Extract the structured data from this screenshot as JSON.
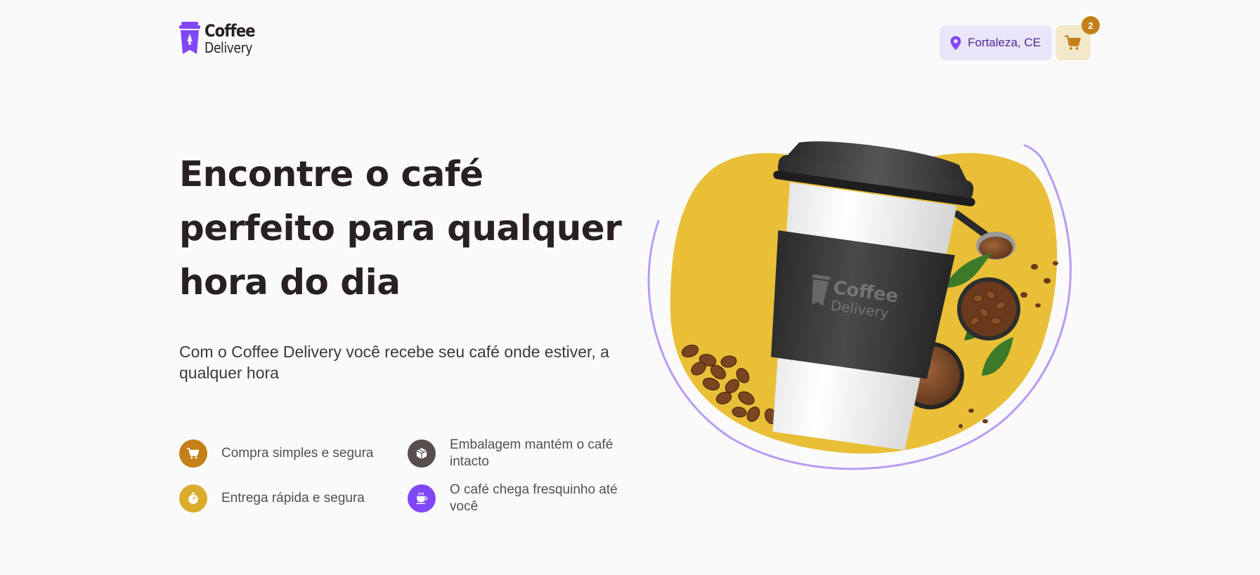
{
  "header": {
    "logo": {
      "line1": "Coffee",
      "line2": "Delivery",
      "icon": "coffee-cup-rocket-icon"
    },
    "location": {
      "text": "Fortaleza, CE",
      "icon": "map-pin-icon"
    },
    "cart": {
      "count": "2",
      "icon": "shopping-cart-icon"
    }
  },
  "hero": {
    "title_lines": [
      "Encontre o café",
      "perfeito para qualquer",
      "hora do dia"
    ],
    "subtitle": "Com o Coffee Delivery você recebe seu café onde estiver, a qualquer hora",
    "features": [
      {
        "label": "Compra simples e segura",
        "icon": "shopping-cart-icon",
        "color": "#C47F17"
      },
      {
        "label": "Embalagem mantém o café intacto",
        "icon": "package-icon",
        "color": "#574F4D"
      },
      {
        "label": "Entrega rápida e segura",
        "icon": "timer-icon",
        "color": "#DBAC2C"
      },
      {
        "label": "O café chega fresquinho até você",
        "icon": "coffee-icon",
        "color": "#8047F8"
      }
    ],
    "image": {
      "cup_logo_line1": "Coffee",
      "cup_logo_line2": "Delivery"
    }
  },
  "colors": {
    "background": "#FAFAFA",
    "purple": "#8047F8",
    "purple_dark": "#4B2995",
    "purple_light": "#EBE5F9",
    "yellow": "#DBAC2C",
    "yellow_dark": "#C47F17",
    "yellow_light": "#F1E9C9",
    "text_title": "#272221",
    "text_subtitle": "#403937"
  }
}
